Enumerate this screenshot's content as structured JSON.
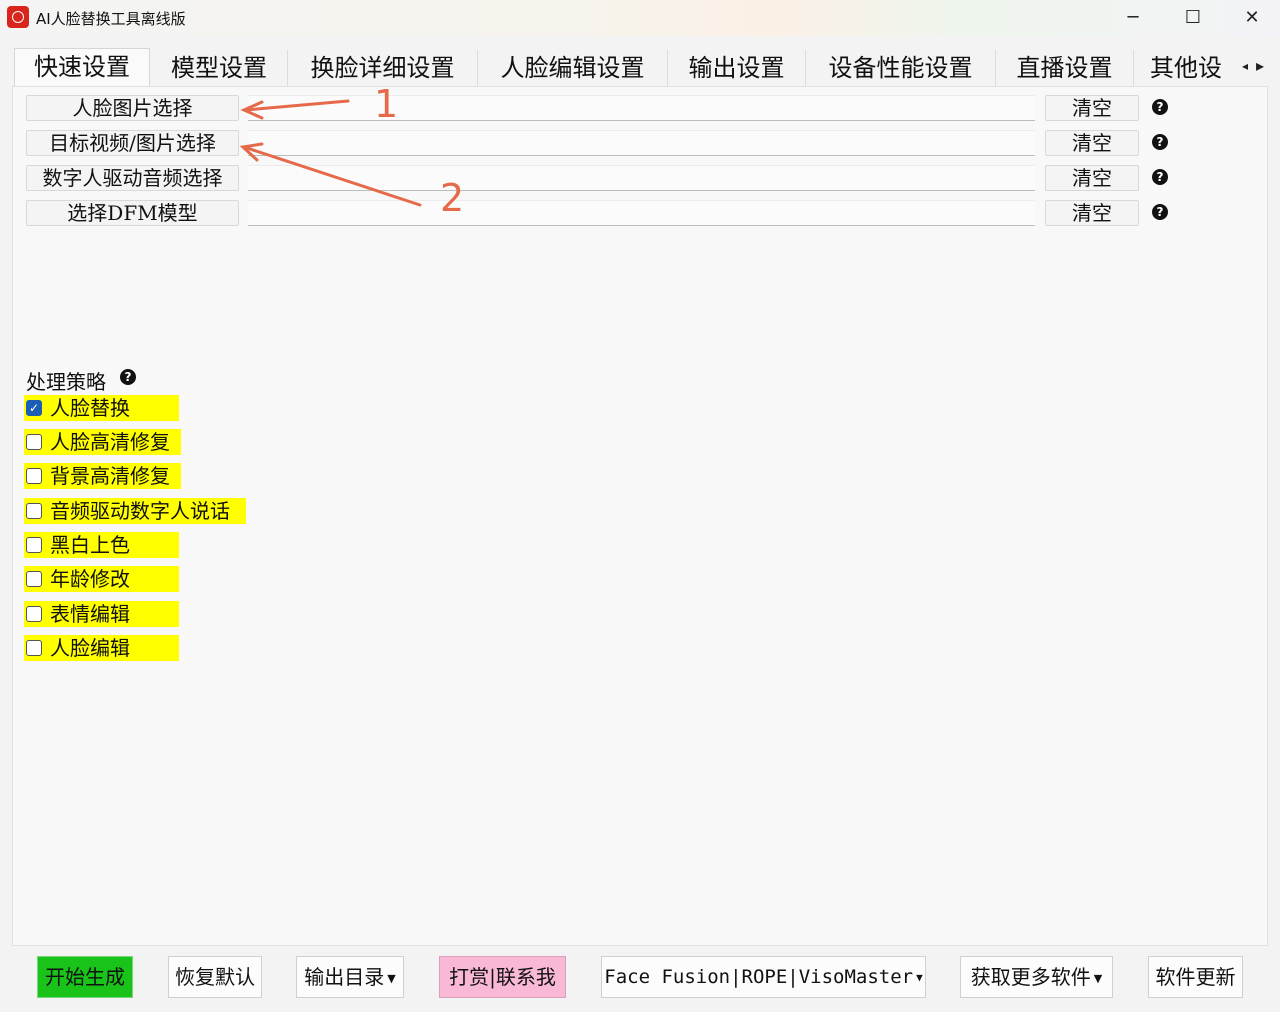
{
  "window": {
    "title": "AI人脸替换工具离线版",
    "icon": "app-logo-icon",
    "controls": {
      "minimize": "─",
      "maximize": "☐",
      "close": "✕"
    }
  },
  "tabs": [
    {
      "label": "快速设置",
      "active": true
    },
    {
      "label": "模型设置"
    },
    {
      "label": "换脸详细设置"
    },
    {
      "label": "人脸编辑设置"
    },
    {
      "label": "输出设置"
    },
    {
      "label": "设备性能设置"
    },
    {
      "label": "直播设置"
    },
    {
      "label": "其他设"
    }
  ],
  "tab_scroll": {
    "left": "◂",
    "right": "▸"
  },
  "file_rows": [
    {
      "button": "人脸图片选择",
      "value": "",
      "clear": "清空",
      "help": "?"
    },
    {
      "button": "目标视频/图片选择",
      "value": "",
      "clear": "清空",
      "help": "?"
    },
    {
      "button": "数字人驱动音频选择",
      "value": "",
      "clear": "清空",
      "help": "?"
    },
    {
      "button": "选择DFM模型",
      "value": "",
      "clear": "清空",
      "help": "?"
    }
  ],
  "annotations": [
    "1",
    "2"
  ],
  "strategy": {
    "label": "处理策略",
    "help": "?",
    "options": [
      {
        "label": "人脸替换",
        "checked": true
      },
      {
        "label": "人脸高清修复",
        "checked": false
      },
      {
        "label": "背景高清修复",
        "checked": false
      },
      {
        "label": "音频驱动数字人说话",
        "checked": false
      },
      {
        "label": "黑白上色",
        "checked": false
      },
      {
        "label": "年龄修改",
        "checked": false
      },
      {
        "label": "表情编辑",
        "checked": false
      },
      {
        "label": "人脸编辑",
        "checked": false
      }
    ]
  },
  "bottom_buttons": {
    "start": "开始生成",
    "reset": "恢复默认",
    "output_dir": "输出目录",
    "donate": "打赏|联系我",
    "engines": "Face Fusion|ROPE|VisoMaster",
    "more_software": "获取更多软件",
    "update": "软件更新"
  },
  "colors": {
    "accent_blue": "#1a5fb4",
    "highlight_yellow": "#ffff00",
    "start_green": "#19c319",
    "donate_pink": "#f8b8d6",
    "annotation_orange": "#e56a4a"
  }
}
